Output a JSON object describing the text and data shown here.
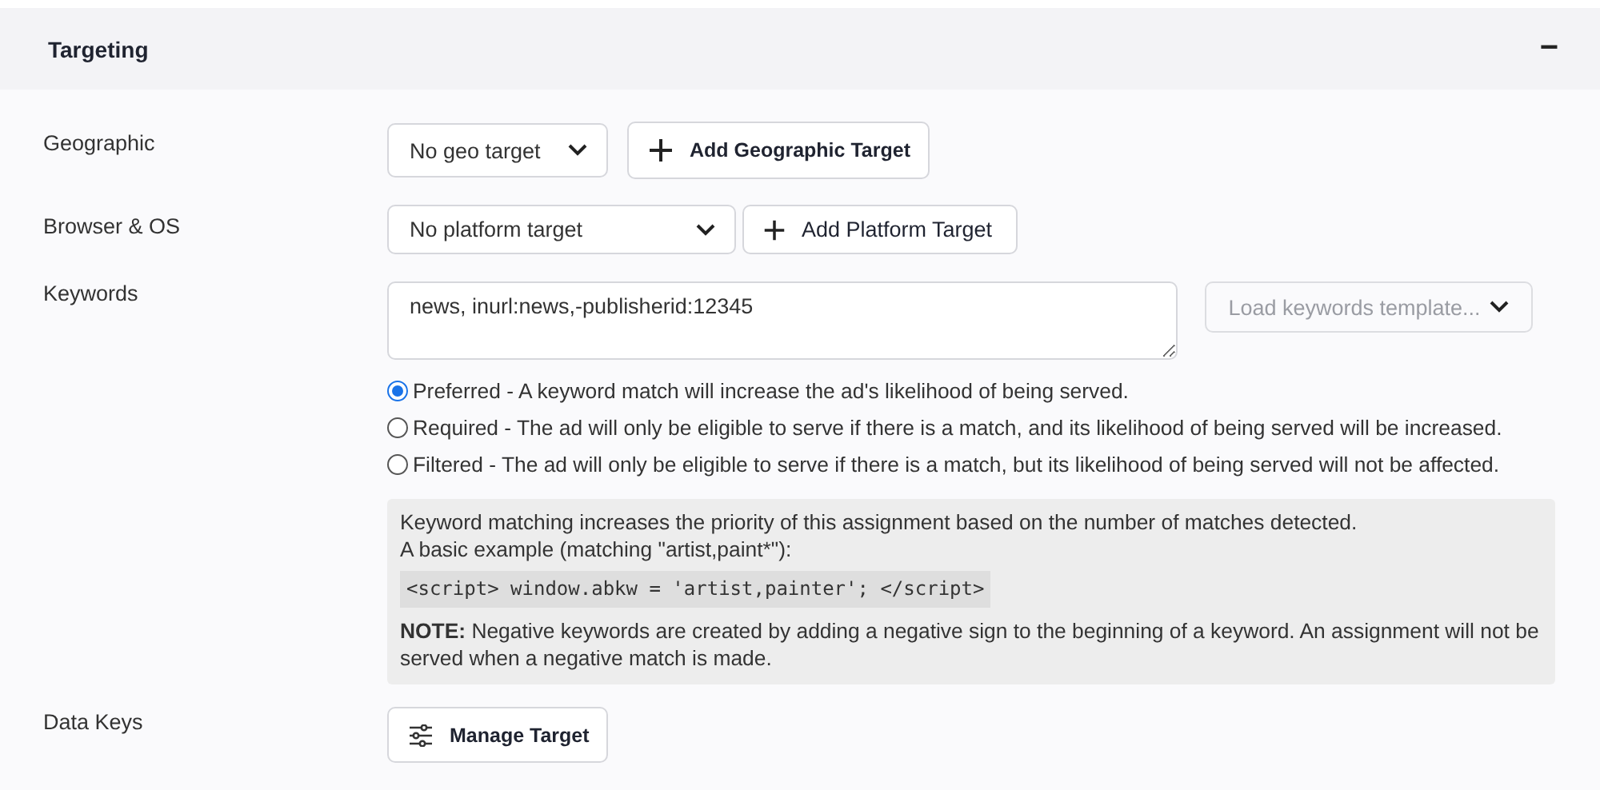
{
  "section": {
    "title": "Targeting",
    "collapse_icon": "−",
    "expanded": true
  },
  "geographic": {
    "label": "Geographic",
    "select": "No geo target",
    "button": "Add Geographic Target"
  },
  "browser_os": {
    "label": "Browser & OS",
    "select": "No platform target",
    "button": "Add Platform Target"
  },
  "keywords": {
    "label": "Keywords",
    "value": "news, inurl:news,-publisherid:12345",
    "template_button": "Load keywords template...",
    "template_disabled": true,
    "options": [
      {
        "label": "Preferred - A keyword match will increase the ad's likelihood of being served.",
        "selected": true
      },
      {
        "label": "Required - The ad will only be eligible to serve if there is a match, and its likelihood of being served will be increased.",
        "selected": false
      },
      {
        "label": "Filtered - The ad will only be eligible to serve if there is a match, but its likelihood of being served will not be affected.",
        "selected": false
      }
    ],
    "help": {
      "line_1": "Keyword matching increases the priority of this assignment based on the number of matches detected.",
      "line_2": "A basic example (matching \"artist,paint*\"):",
      "code": "<script> window.abkw = 'artist,painter'; </script>",
      "note": "**NOTE:** Negative keywords are created by adding a negative sign to the beginning of a keyword. An assignment will not be served when a negative match is made."
    }
  },
  "data_keys": {
    "label": "Data Keys",
    "button": "Manage Target"
  }
}
